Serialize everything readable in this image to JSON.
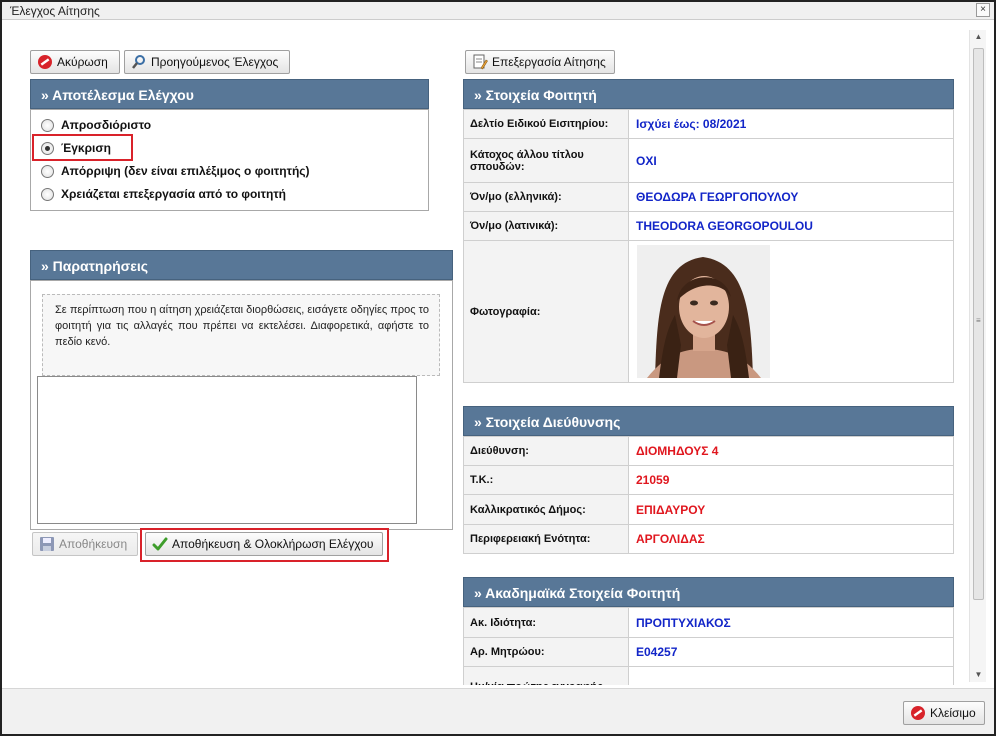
{
  "window": {
    "title": "Έλεγχος Αίτησης",
    "close_glyph": "×"
  },
  "toolbar": {
    "cancel_label": "Ακύρωση",
    "previous_label": "Προηγούμενος Έλεγχος",
    "edit_label": "Επεξεργασία Αίτησης"
  },
  "result": {
    "heading": "» Αποτέλεσμα Ελέγχου",
    "options": [
      {
        "label": "Απροσδιόριστο",
        "checked": false
      },
      {
        "label": "Έγκριση",
        "checked": true
      },
      {
        "label": "Απόρριψη (δεν είναι επιλέξιμος ο φοιτητής)",
        "checked": false
      },
      {
        "label": "Χρειάζεται επεξεργασία από το φοιτητή",
        "checked": false
      }
    ]
  },
  "notes": {
    "heading": "» Παρατηρήσεις",
    "info": "Σε περίπτωση που η αίτηση χρειάζεται διορθώσεις, εισάγετε οδηγίες προς το φοιτητή για τις αλλαγές που πρέπει να εκτελέσει. Διαφορετικά, αφήστε το πεδίο κενό.",
    "value": ""
  },
  "actions": {
    "save_label": "Αποθήκευση",
    "save_complete_label": "Αποθήκευση & Ολοκλήρωση Ελέγχου",
    "close_label": "Κλείσιμο"
  },
  "student": {
    "heading": "» Στοιχεία Φοιτητή",
    "rows": [
      {
        "label": "Δελτίο Ειδικού Εισιτηρίου:",
        "value": "Ισχύει έως: 08/2021"
      },
      {
        "label": "Κάτοχος άλλου τίτλου σπουδών:",
        "value": "ΟΧΙ"
      },
      {
        "label": "Όν/μο (ελληνικά):",
        "value": "ΘΕΟΔΩΡΑ ΓΕΩΡΓΟΠΟΥΛΟΥ"
      },
      {
        "label": "Όν/μο (λατινικά):",
        "value": "THEODORA GEORGOPOULOU"
      },
      {
        "label": "Φωτογραφία:",
        "value": ""
      }
    ]
  },
  "address": {
    "heading": "» Στοιχεία Διεύθυνσης",
    "rows": [
      {
        "label": "Διεύθυνση:",
        "value": "ΔΙΟΜΗΔΟΥΣ 4"
      },
      {
        "label": "Τ.Κ.:",
        "value": "21059"
      },
      {
        "label": "Καλλικρατικός Δήμος:",
        "value": "ΕΠΙΔΑΥΡΟΥ"
      },
      {
        "label": "Περιφερειακή Ενότητα:",
        "value": "ΑΡΓΟΛΙΔΑΣ"
      }
    ]
  },
  "academic": {
    "heading": "» Ακαδημαϊκά Στοιχεία Φοιτητή",
    "rows": [
      {
        "label": "Ακ. Ιδιότητα:",
        "value": "ΠΡΟΠΤΥΧΙΑΚΟΣ"
      },
      {
        "label": "Αρ. Μητρώου:",
        "value": "Ε04257"
      },
      {
        "label": "Ημ/νία πρώτης εγγραφής",
        "value": ""
      }
    ]
  },
  "colors": {
    "header_bg": "#587797",
    "value_blue": "#1225c8",
    "value_red": "#e0161e",
    "highlight_red": "#d9222a"
  }
}
